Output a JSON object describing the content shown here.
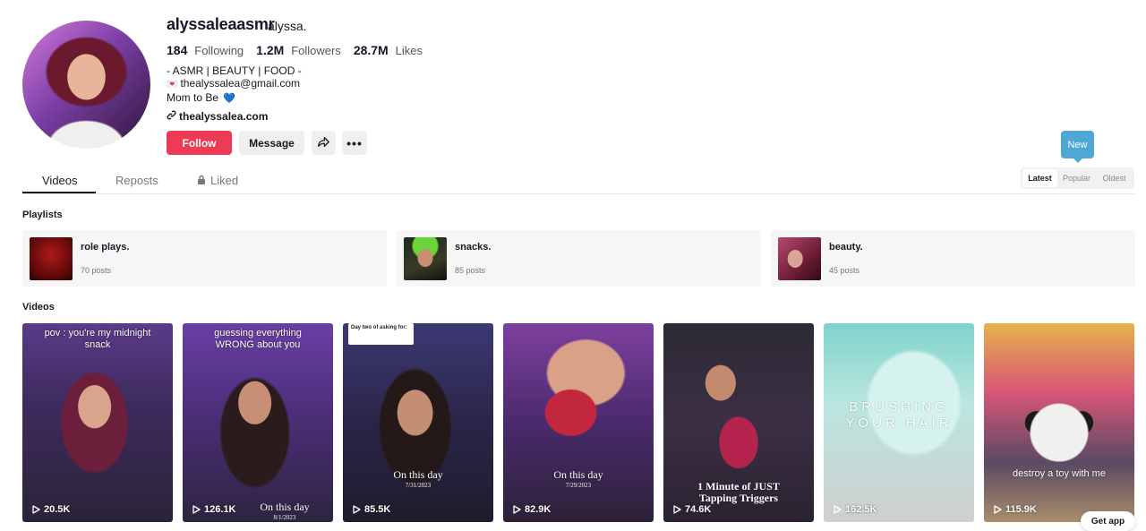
{
  "profile": {
    "username": "alyssaleaasmr",
    "nickname": "alyssa.",
    "stats": [
      {
        "value": "184",
        "label": "Following"
      },
      {
        "value": "1.2M",
        "label": "Followers"
      },
      {
        "value": "28.7M",
        "label": "Likes"
      }
    ],
    "bio": [
      "- ASMR | BEAUTY | FOOD -",
      "thealyssalea@gmail.com",
      "Mom to Be"
    ],
    "link": "thealyssalea.com"
  },
  "actions": {
    "follow": "Follow",
    "message": "Message"
  },
  "tabs": [
    "Videos",
    "Reposts",
    "Liked"
  ],
  "tooltip": "New",
  "sort": [
    "Latest",
    "Popular",
    "Oldest"
  ],
  "playlists_title": "Playlists",
  "videos_title": "Videos",
  "playlists": [
    {
      "name": "role plays.",
      "count": "70 posts"
    },
    {
      "name": "snacks.",
      "count": "85 posts"
    },
    {
      "name": "beauty.",
      "count": "45 posts"
    }
  ],
  "videos": [
    {
      "caption": "pov : you're my midnight snack",
      "views": "20.5K"
    },
    {
      "caption": "guessing everything WRONG about you",
      "overlay": "On this day",
      "overlay_date": "8/1/2023",
      "views": "126.1K"
    },
    {
      "sticker": "Day two of asking for:",
      "overlay": "On this day",
      "overlay_date": "7/31/2023",
      "views": "85.5K"
    },
    {
      "overlay": "On this day",
      "overlay_date": "7/29/2023",
      "views": "82.9K"
    },
    {
      "overlay": "1 Minute of JUST Tapping Triggers",
      "views": "74.6K"
    },
    {
      "overlay": "BRUSHING YOUR HAIR",
      "views": "162.5K"
    },
    {
      "caption": "destroy a toy with me",
      "views": "115.9K"
    }
  ],
  "get_app": "Get app",
  "colors": {
    "follow_bg": "#ef3a55",
    "tooltip_bg": "#4fa8d3"
  }
}
